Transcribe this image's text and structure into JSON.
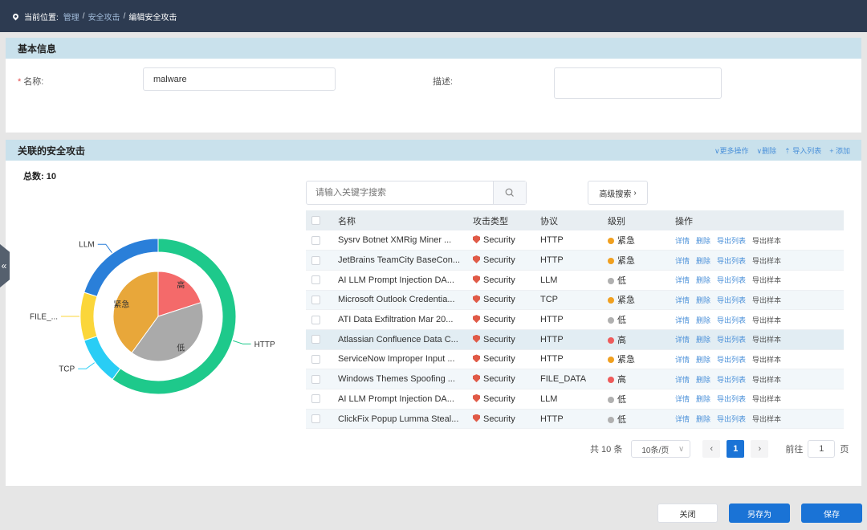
{
  "breadcrumb": {
    "prefix": "当前位置:",
    "items": [
      "管理",
      "安全攻击",
      "编辑安全攻击"
    ]
  },
  "basic": {
    "title": "基本信息",
    "name_label": "名称:",
    "name_value": "malware",
    "desc_label": "描述:",
    "desc_value": ""
  },
  "related": {
    "title": "关联的安全攻击",
    "actions": [
      "更多操作",
      "删除",
      "导入列表",
      "添加"
    ],
    "total": "总数: 10",
    "search_placeholder": "请输入关键字搜索",
    "advanced_label": "高级搜索",
    "columns": [
      "名称",
      "攻击类型",
      "协议",
      "级别",
      "操作"
    ],
    "row_actions": [
      "详情",
      "删除",
      "导出列表",
      "导出样本"
    ],
    "rows": [
      {
        "name": "Sysrv Botnet XMRig Miner ...",
        "type": "Security",
        "protocol": "HTTP",
        "level": "紧急",
        "level_color": "#f0a020"
      },
      {
        "name": "JetBrains TeamCity BaseCon...",
        "type": "Security",
        "protocol": "HTTP",
        "level": "紧急",
        "level_color": "#f0a020"
      },
      {
        "name": "AI LLM Prompt Injection DA...",
        "type": "Security",
        "protocol": "LLM",
        "level": "低",
        "level_color": "#b0b0b0"
      },
      {
        "name": "Microsoft Outlook Credentia...",
        "type": "Security",
        "protocol": "TCP",
        "level": "紧急",
        "level_color": "#f0a020"
      },
      {
        "name": "ATI Data Exfiltration Mar 20...",
        "type": "Security",
        "protocol": "HTTP",
        "level": "低",
        "level_color": "#b0b0b0"
      },
      {
        "name": "Atlassian Confluence Data C...",
        "type": "Security",
        "protocol": "HTTP",
        "level": "高",
        "level_color": "#ee5b5b"
      },
      {
        "name": "ServiceNow Improper Input ...",
        "type": "Security",
        "protocol": "HTTP",
        "level": "紧急",
        "level_color": "#f0a020"
      },
      {
        "name": "Windows Themes Spoofing ...",
        "type": "Security",
        "protocol": "FILE_DATA",
        "level": "高",
        "level_color": "#ee5b5b"
      },
      {
        "name": "AI LLM Prompt Injection DA...",
        "type": "Security",
        "protocol": "LLM",
        "level": "低",
        "level_color": "#b0b0b0"
      },
      {
        "name": "ClickFix Popup Lumma Steal...",
        "type": "Security",
        "protocol": "HTTP",
        "level": "低",
        "level_color": "#b0b0b0"
      }
    ],
    "pagination": {
      "total_text": "共 10 条",
      "page_size": "10条/页",
      "current_page": "1",
      "goto_prefix": "前往",
      "goto_value": "1",
      "goto_suffix": "页"
    }
  },
  "chart_data": {
    "type": "pie",
    "rings": [
      {
        "name": "",
        "labels": [
          "HTTP",
          "TCP",
          "FILE_...",
          "LLM"
        ],
        "values": [
          6,
          1,
          1,
          2
        ],
        "colors": [
          "#1ec98b",
          "#29cdf5",
          "#fbd63a",
          "#2a7fd9"
        ]
      },
      {
        "name": "",
        "labels": [
          "高",
          "低",
          "紧急"
        ],
        "values": [
          2,
          4,
          4
        ],
        "colors": [
          "#f46a6a",
          "#aaaaaa",
          "#e8a73a"
        ]
      }
    ]
  },
  "footer": {
    "close_label": "关闭",
    "saveas_label": "另存为",
    "save_label": "保存"
  }
}
